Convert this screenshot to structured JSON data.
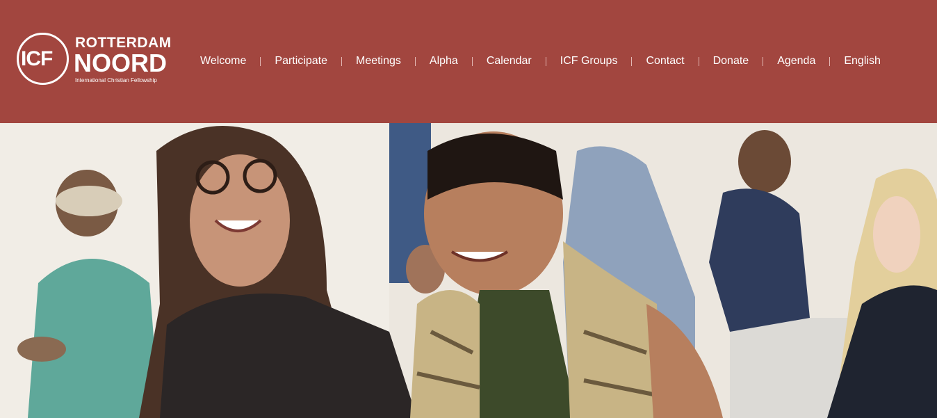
{
  "logo": {
    "abbr": "ICF",
    "line1": "ROTTERDAM",
    "line2": "NOORD",
    "line3": "International Christian Fellowship"
  },
  "nav": {
    "items": [
      {
        "label": "Welcome"
      },
      {
        "label": "Participate"
      },
      {
        "label": "Meetings"
      },
      {
        "label": "Alpha"
      },
      {
        "label": "Calendar"
      },
      {
        "label": "ICF Groups"
      },
      {
        "label": "Contact"
      },
      {
        "label": "Donate"
      },
      {
        "label": "Agenda"
      },
      {
        "label": "English"
      }
    ]
  },
  "colors": {
    "header_bg": "#a2463f",
    "nav_text": "#ffffff"
  },
  "hero": {
    "image": "photo-of-smiling-women-at-church-gathering"
  }
}
